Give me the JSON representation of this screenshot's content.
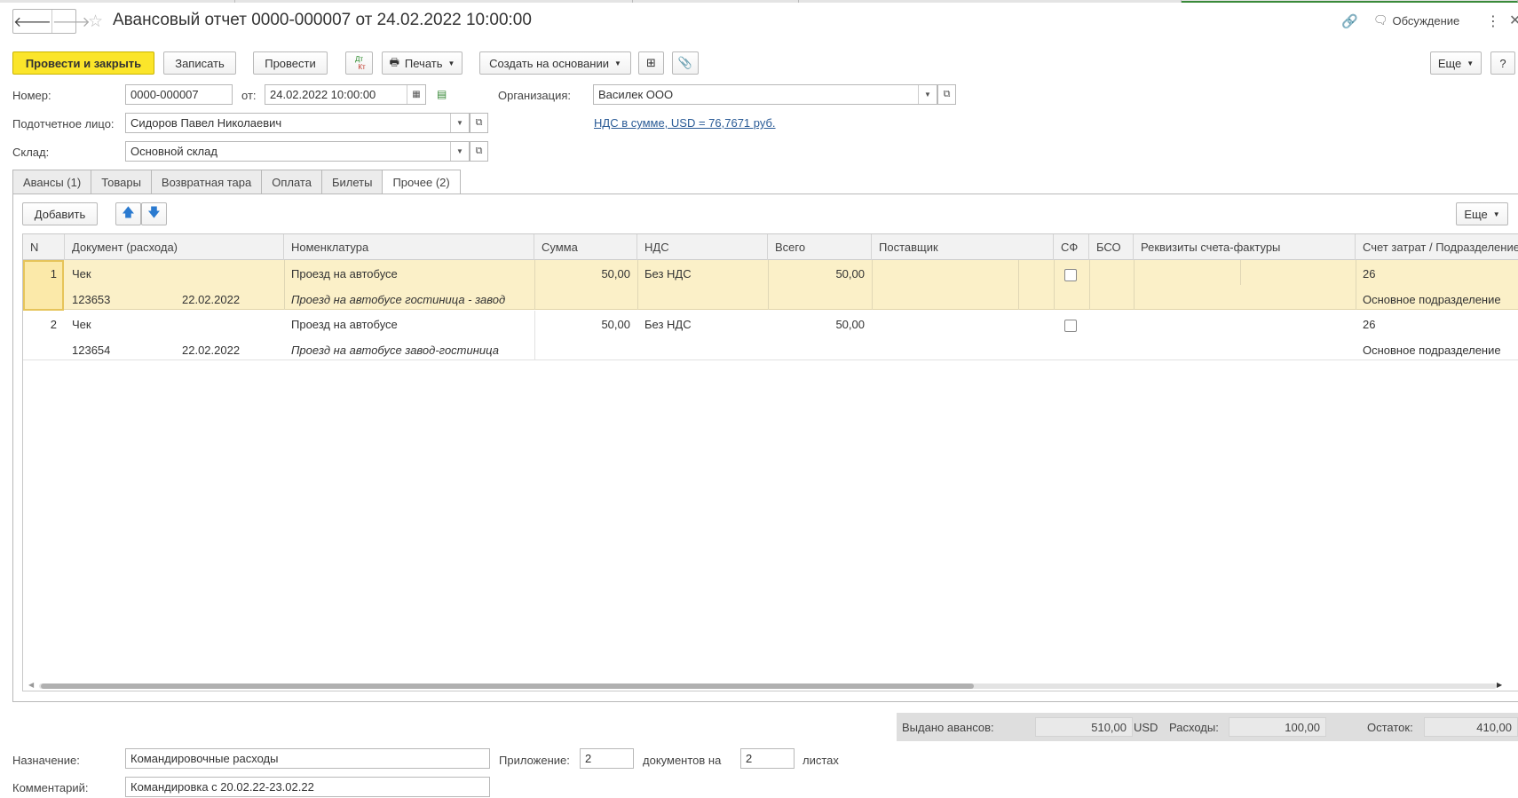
{
  "window": {
    "title": "Авансовый отчет 0000-000007 от 24.02.2022 10:00:00",
    "discussion_label": "Обсуждение"
  },
  "toolbar": {
    "post_close": "Провести и закрыть",
    "save": "Записать",
    "post": "Провести",
    "dtkt_icon_text_top": "Дт",
    "dtkt_icon_text_bottom": "Кт",
    "print": "Печать",
    "create_based": "Создать на основании",
    "more": "Еще",
    "help": "?"
  },
  "form": {
    "number_label": "Номер:",
    "number_value": "0000-000007",
    "date_label": "от:",
    "date_value": "24.02.2022 10:00:00",
    "org_label": "Организация:",
    "org_value": "Василек ООО",
    "person_label": "Подотчетное лицо:",
    "person_value": "Сидоров Павел Николаевич",
    "vat_link": "НДС в сумме, USD = 76,7671 руб.",
    "warehouse_label": "Склад:",
    "warehouse_value": "Основной склад"
  },
  "tabs": [
    {
      "label": "Авансы (1)"
    },
    {
      "label": "Товары"
    },
    {
      "label": "Возвратная тара"
    },
    {
      "label": "Оплата"
    },
    {
      "label": "Билеты"
    },
    {
      "label": "Прочее (2)"
    }
  ],
  "table_toolbar": {
    "add": "Добавить",
    "more": "Еще"
  },
  "table": {
    "headers": {
      "n": "N",
      "doc": "Документ (расхода)",
      "nom": "Номенклатура",
      "sum": "Сумма",
      "vat": "НДС",
      "total": "Всего",
      "supplier": "Поставщик",
      "sf": "СФ",
      "bso": "БСО",
      "invoice": "Реквизиты счета-фактуры",
      "account": "Счет затрат / Подразделение"
    },
    "rows": [
      {
        "n": "1",
        "doc_type": "Чек",
        "doc_number": "123653",
        "doc_date": "22.02.2022",
        "nom": "Проезд на автобусе",
        "nom_desc": "Проезд на автобусе гостиница - завод",
        "sum": "50,00",
        "vat": "Без НДС",
        "total": "50,00",
        "sf_checked": false,
        "account": "26",
        "department": "Основное подразделение"
      },
      {
        "n": "2",
        "doc_type": "Чек",
        "doc_number": "123654",
        "doc_date": "22.02.2022",
        "nom": "Проезд на автобусе",
        "nom_desc": "Проезд на автобусе завод-гостиница",
        "sum": "50,00",
        "vat": "Без НДС",
        "total": "50,00",
        "sf_checked": false,
        "account": "26",
        "department": "Основное подразделение"
      }
    ],
    "scroll_position": 0.64
  },
  "totals": {
    "issued_label": "Выдано авансов:",
    "issued_value": "510,00",
    "currency": "USD",
    "expenses_label": "Расходы:",
    "expenses_value": "100,00",
    "balance_label": "Остаток:",
    "balance_value": "410,00"
  },
  "footer": {
    "purpose_label": "Назначение:",
    "purpose_value": "Командировочные расходы",
    "attachment_label": "Приложение:",
    "attachment_value": "2",
    "docs_on_label": "документов на",
    "sheets_value": "2",
    "sheets_label": "листах",
    "comment_label": "Комментарий:",
    "comment_value": "Командировка с 20.02.22-23.02.22"
  },
  "colors": {
    "primary_button": "#fbe52a",
    "selected_row": "#fbf0c8",
    "link": "#2a5b96"
  }
}
